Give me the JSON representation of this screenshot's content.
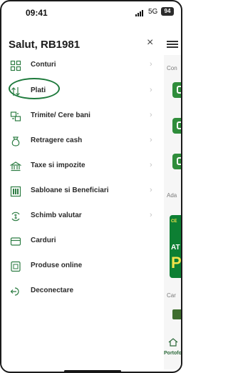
{
  "status_bar": {
    "time": "09:41",
    "network": "5G",
    "battery": "94"
  },
  "header": {
    "greeting": "Salut, RB1981",
    "close_symbol": "×"
  },
  "menu": {
    "items": [
      {
        "label": "Conturi",
        "icon": "grid-icon"
      },
      {
        "label": "Plati",
        "icon": "transfer-arrows-icon"
      },
      {
        "label": "Trimite/ Cere bani",
        "icon": "send-request-icon"
      },
      {
        "label": "Retragere cash",
        "icon": "cash-bag-icon"
      },
      {
        "label": "Taxe si impozite",
        "icon": "bank-building-icon"
      },
      {
        "label": "Sabloane si Beneficiari",
        "icon": "templates-icon"
      },
      {
        "label": "Schimb valutar",
        "icon": "currency-exchange-icon"
      },
      {
        "label": "Carduri",
        "icon": "card-icon"
      },
      {
        "label": "Produse online",
        "icon": "online-product-icon"
      },
      {
        "label": "Deconectare",
        "icon": "logout-icon"
      }
    ],
    "chevron": "›"
  },
  "background": {
    "section1": "Con",
    "section2": "Ada",
    "section3": "Car",
    "promo_top": "CE",
    "promo_mid": "AT",
    "promo_big": "P",
    "nav_home": "Portofo"
  },
  "colors": {
    "accent_green": "#1e7a3c",
    "promo_green": "#0d7f33",
    "promo_yellow": "#f1e34a"
  }
}
